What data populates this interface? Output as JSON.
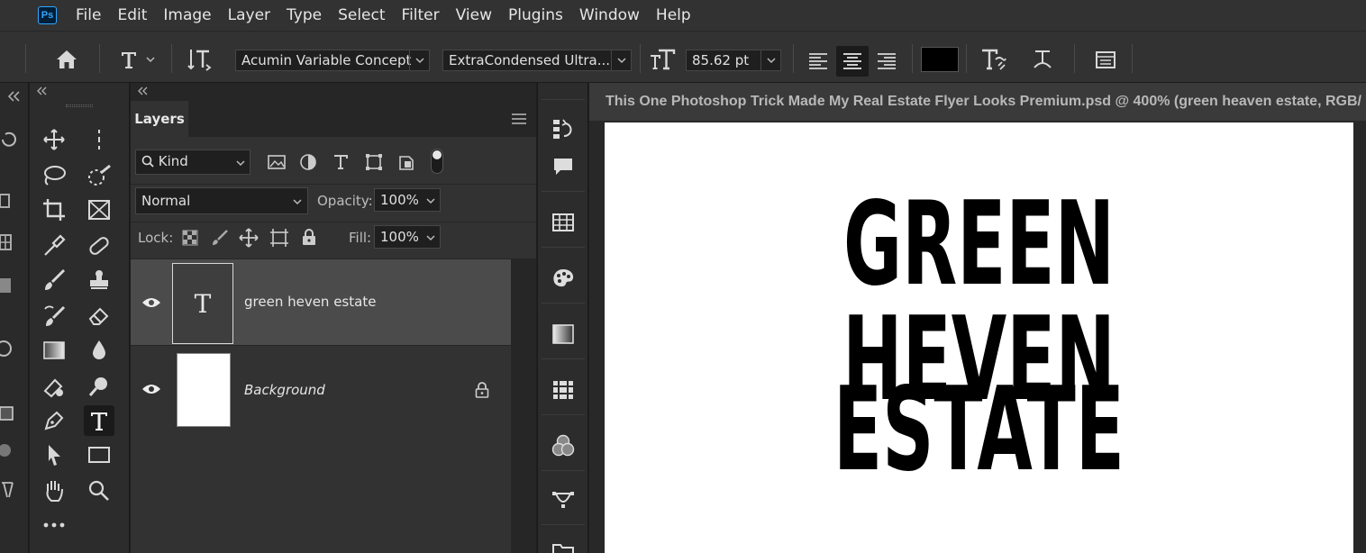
{
  "menu": {
    "logo": "Ps",
    "items": [
      "File",
      "Edit",
      "Image",
      "Layer",
      "Type",
      "Select",
      "Filter",
      "View",
      "Plugins",
      "Window",
      "Help"
    ]
  },
  "options_bar": {
    "font_family": "Acumin Variable Concept",
    "font_style": "ExtraCondensed Ultra...",
    "font_size": "85.62 pt",
    "text_color": "#000000"
  },
  "layers_panel": {
    "tab_label": "Layers",
    "filter_kind": "Kind",
    "blend_mode": "Normal",
    "opacity_label": "Opacity:",
    "opacity_value": "100%",
    "lock_label": "Lock:",
    "fill_label": "Fill:",
    "fill_value": "100%",
    "layers": [
      {
        "name": "green heven estate",
        "type": "text",
        "selected": true,
        "thumb_glyph": "T"
      },
      {
        "name": "Background",
        "type": "image",
        "selected": false,
        "locked": true
      }
    ]
  },
  "document": {
    "tab_title": "This One Photoshop Trick Made My Real Estate Flyer Looks Premium.psd @ 400% (green heaven  estate, RGB/",
    "canvas_lines": [
      "GREEN HEVEN",
      "ESTATE"
    ]
  },
  "colors": {
    "accent_ps": "#31a8ff",
    "panel_bg": "#323232",
    "canvas": "#ffffff"
  }
}
